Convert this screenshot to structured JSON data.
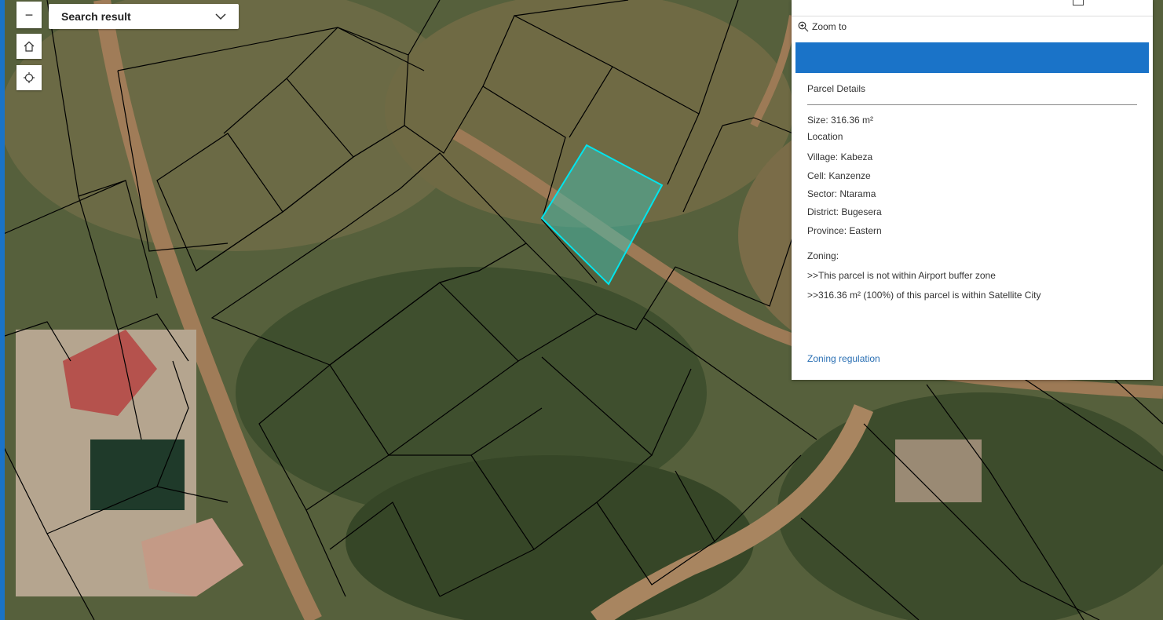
{
  "search": {
    "label": "Search result"
  },
  "map_controls": {
    "zoom_out": "−",
    "home_icon": "home-icon",
    "locate_icon": "locate-icon"
  },
  "popup": {
    "zoom_to": "Zoom to",
    "section_title": "Parcel Details",
    "size": "Size: 316.36 m²",
    "location_label": "Location",
    "village": "Village: Kabeza",
    "cell": "Cell: Kanzenze",
    "sector": "Sector: Ntarama",
    "district": "District: Bugesera",
    "province": "Province: Eastern",
    "zoning_label": "Zoning:",
    "zoning_airport": ">>This parcel is not within Airport buffer zone",
    "zoning_satellite": ">>316.36 m² (100%) of this parcel is within Satellite City",
    "regulation_link": "Zoning regulation"
  },
  "colors": {
    "accent": "#1a73c8",
    "selection": "#00e5ee",
    "link": "#2a6fb3"
  }
}
